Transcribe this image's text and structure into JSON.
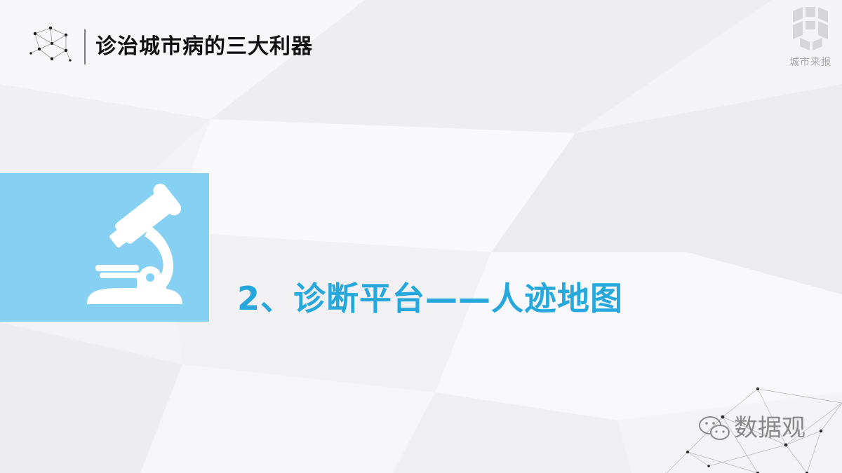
{
  "slide": {
    "title": "诊治城市病的三大利器",
    "section_title": "2、诊断平台——人迹地图"
  },
  "brand": {
    "logo_text": "城市来报"
  },
  "watermark": {
    "text": "数据观"
  },
  "colors": {
    "accent": "#27a8dc",
    "feature_box": "#86d1f3",
    "title_text": "#111111",
    "background": "#f3f3f5"
  },
  "icons": {
    "header": "network-graph-icon",
    "feature": "microscope-icon",
    "watermark": "wechat-icon"
  }
}
